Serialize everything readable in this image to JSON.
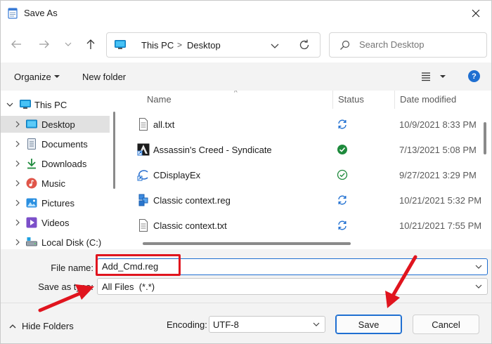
{
  "window": {
    "title": "Save As"
  },
  "address": {
    "segments": [
      "This PC",
      "Desktop"
    ]
  },
  "search": {
    "placeholder": "Search Desktop"
  },
  "commandbar": {
    "organize": "Organize",
    "new_folder": "New folder",
    "help": "?"
  },
  "nav_tree": [
    {
      "label": "This PC",
      "icon": "pc-icon",
      "expanded": true,
      "selected": false
    },
    {
      "label": "Desktop",
      "icon": "desktop-icon",
      "expanded": false,
      "selected": true
    },
    {
      "label": "Documents",
      "icon": "documents-icon",
      "expanded": false,
      "selected": false
    },
    {
      "label": "Downloads",
      "icon": "downloads-icon",
      "expanded": false,
      "selected": false
    },
    {
      "label": "Music",
      "icon": "music-icon",
      "expanded": false,
      "selected": false
    },
    {
      "label": "Pictures",
      "icon": "pictures-icon",
      "expanded": false,
      "selected": false
    },
    {
      "label": "Videos",
      "icon": "videos-icon",
      "expanded": false,
      "selected": false
    },
    {
      "label": "Local Disk (C:)",
      "icon": "drive-icon",
      "expanded": false,
      "selected": false
    }
  ],
  "columns": {
    "name": "Name",
    "status": "Status",
    "date_modified": "Date modified"
  },
  "files": [
    {
      "name": "all.txt",
      "icon": "text-file-icon",
      "status": "sync-pending-icon",
      "date": "10/9/2021 8:33 PM"
    },
    {
      "name": "Assassin's Creed - Syndicate",
      "icon": "game-shortcut-icon",
      "status": "available-offline-icon",
      "date": "7/13/2021 5:08 PM"
    },
    {
      "name": "CDisplayEx",
      "icon": "app-shortcut-icon",
      "status": "available-locally-icon",
      "date": "9/27/2021 3:29 PM"
    },
    {
      "name": "Classic context.reg",
      "icon": "registry-file-icon",
      "status": "sync-pending-icon",
      "date": "10/21/2021 5:32 PM"
    },
    {
      "name": "Classic context.txt",
      "icon": "text-file-icon",
      "status": "sync-pending-icon",
      "date": "10/21/2021 7:55 PM"
    }
  ],
  "form": {
    "file_name_label": "File name:",
    "file_name_value": "Add_Cmd.reg",
    "save_as_type_label": "Save as type:",
    "save_as_type_value": "All Files  (*.*)"
  },
  "footer": {
    "hide_folders": "Hide Folders",
    "encoding_label": "Encoding:",
    "encoding_value": "UTF-8",
    "save": "Save",
    "cancel": "Cancel"
  },
  "colors": {
    "accent": "#1f6fd1",
    "annotation": "#e0141e",
    "status_green": "#1e8a3c"
  }
}
